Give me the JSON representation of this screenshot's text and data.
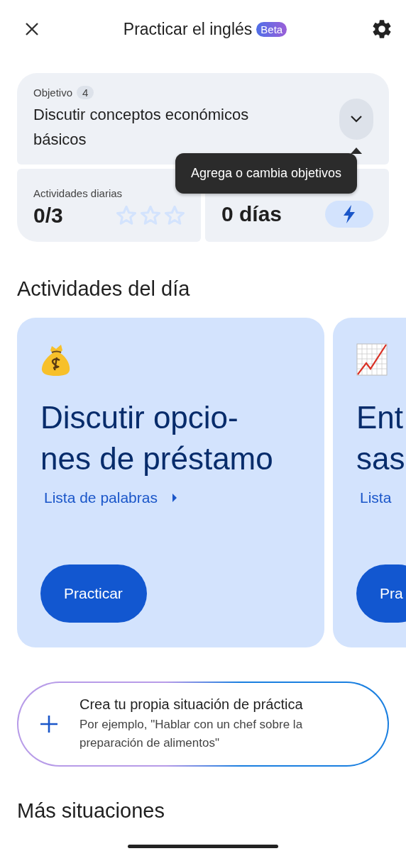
{
  "header": {
    "title": "Practicar el inglés",
    "badge": "Beta"
  },
  "goal": {
    "label": "Objetivo",
    "count": "4",
    "text": "Discutir conceptos económicos básicos"
  },
  "tooltip": "Agrega o cambia objetivos",
  "daily": {
    "label": "Actividades diarias",
    "value": "0/3",
    "stars": 0
  },
  "streak": {
    "value": "0 días"
  },
  "section_title": "Actividades del día",
  "activities": [
    {
      "title_lines": [
        "Discutir opcio-",
        "nes de préstamo"
      ],
      "link": "Lista de palabras",
      "button": "Practicar"
    },
    {
      "title_lines": [
        "Ent",
        "sas"
      ],
      "link": "Lista",
      "button": "Pra"
    }
  ],
  "create": {
    "title": "Crea tu propia situación de práctica",
    "hint": "Por ejemplo, \"Hablar con un chef sobre la preparación de alimentos\""
  },
  "more_title": "Más situaciones"
}
